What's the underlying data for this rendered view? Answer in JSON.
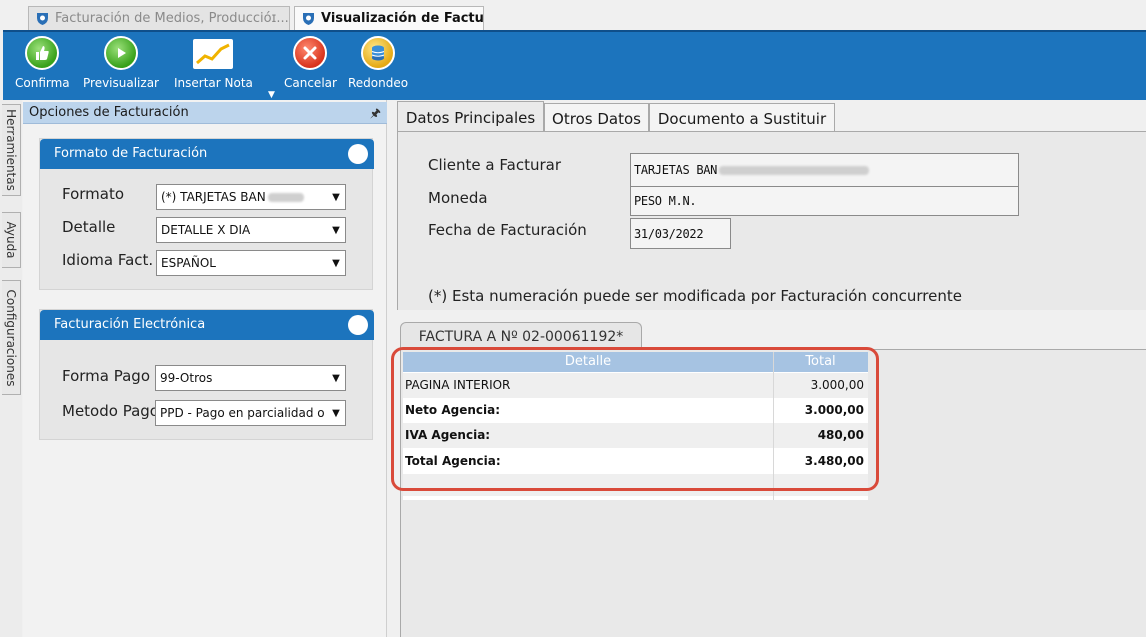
{
  "doc_tabs": [
    {
      "label": "Facturación de Medios, Produccióɪ...",
      "active": false
    },
    {
      "label": "Visualización de Factura",
      "active": true
    }
  ],
  "toolbar": {
    "confirma": "Confirma",
    "previsualizar": "Previsualizar",
    "insertar_nota": "Insertar Nota",
    "cancelar": "Cancelar",
    "redondeo": "Redondeo"
  },
  "side_tabs": [
    "Herramientas",
    "Ayuda",
    "Configuraciones"
  ],
  "left_panel": {
    "title": "Opciones de Facturación",
    "formato_group": {
      "title": "Formato de Facturación",
      "formato_label": "Formato",
      "formato_value": "(*) TARJETAS BAN",
      "detalle_label": "Detalle",
      "detalle_value": "DETALLE X DIA",
      "idioma_label": "Idioma Fact.",
      "idioma_value": "ESPAÑOL"
    },
    "electronica_group": {
      "title": "Facturación Electrónica",
      "forma_pago_label": "Forma Pago",
      "forma_pago_value": "99-Otros",
      "metodo_pago_label": "Metodo Pago",
      "metodo_pago_value": "PPD - Pago en parcialidad o"
    }
  },
  "main_tabs": [
    {
      "label": "Datos Principales",
      "active": true
    },
    {
      "label": "Otros Datos",
      "active": false
    },
    {
      "label": "Documento a Sustituir",
      "active": false
    }
  ],
  "datos": {
    "cliente_label": "Cliente a Facturar",
    "cliente_value": "TARJETAS BAN",
    "moneda_label": "Moneda",
    "moneda_value": "PESO M.N.",
    "fecha_label": "Fecha de Facturación",
    "fecha_value": "31/03/2022",
    "note": "(*) Esta numeración puede ser modificada por Facturación concurrente"
  },
  "invoice": {
    "tab_label": "FACTURA A Nº 02-00061192*",
    "columns": [
      "Detalle",
      "Total"
    ],
    "rows": [
      {
        "detalle": "PAGINA INTERIOR",
        "total": "3.000,00",
        "bold": false
      },
      {
        "detalle": "Neto Agencia:",
        "total": "3.000,00",
        "bold": true
      },
      {
        "detalle": "IVA Agencia:",
        "total": "480,00",
        "bold": true
      },
      {
        "detalle": "Total Agencia:",
        "total": "3.480,00",
        "bold": true
      }
    ]
  },
  "colors": {
    "ribbon": "#1c74bd",
    "grid_header": "#a6c3e2",
    "highlight": "#d94a3a"
  }
}
